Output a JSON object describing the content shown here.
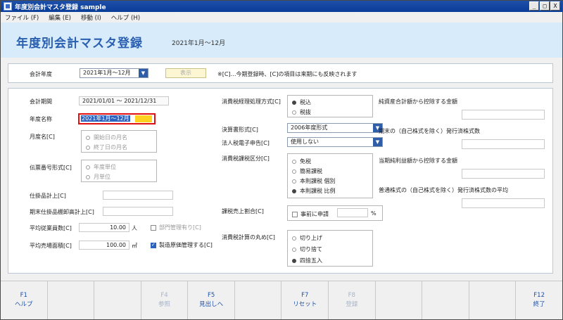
{
  "window": {
    "title": "年度別会計マスタ登録 sample",
    "controls": [
      "_",
      "□",
      "X"
    ]
  },
  "menu": [
    "ファイル (F)",
    "編集 (E)",
    "移動 (I)",
    "ヘルプ (H)"
  ],
  "header": {
    "title": "年度別会計マスタ登録",
    "subtitle": "2021年1月～12月"
  },
  "top": {
    "fiscal_year_label": "会計年度",
    "fiscal_year_value": "2021年1月～12月",
    "show_button": "表示",
    "note": "※[C]…今期登録時、[C]の項目は来期にも反映されます"
  },
  "left": {
    "period_label": "会計期間",
    "period_value": "2021/01/01 ～ 2021/12/31",
    "year_name_label": "年度名称",
    "year_name_value": "2021年1月～12月",
    "month_name_label": "月度名[C]",
    "month_name_options": [
      "開始日の月名",
      "終了日の月名"
    ],
    "slip_format_label": "伝票番号形式[C]",
    "slip_format_options": [
      "年度単位",
      "月単位"
    ],
    "purchase_label": "仕掛品計上[C]",
    "inventory_label": "期末仕掛品棚卸高計上[C]",
    "employees_label": "平均従業員数[C]",
    "employees_value": "10.00",
    "employees_unit": "人",
    "area_label": "平均売場面積[C]",
    "area_value": "100.00",
    "area_unit": "㎡",
    "dept_mgmt_label": "部門管理有り[C]",
    "manufacturing_label": "製造原価管理する[C]"
  },
  "middle": {
    "tax_method_label": "消費税経理処理方式[C]",
    "tax_method_options": [
      "税込",
      "税抜"
    ],
    "statement_label": "決算書形式[C]",
    "statement_value": "2006年度形式",
    "etax_label": "法人税電子申告[C]",
    "etax_value": "使用しない",
    "tax_category_label": "消費税課税区分[C]",
    "tax_category_options": [
      "免税",
      "簡易課税",
      "本則課税 個別",
      "本則課税 比例"
    ],
    "taxable_ratio_label": "課税売上割合[C]",
    "pre_apply_label": "事前に申請",
    "percent": "%",
    "rounding_label": "消費税計算の丸め[C]",
    "rounding_options": [
      "切り上げ",
      "切り捨て",
      "四捨五入"
    ]
  },
  "right": {
    "net_assets_label": "純資産合計額から控除する金額",
    "shares_label": "期末の（自己株式を除く）発行済株式数",
    "net_income_label": "当期純利益額から控除する金額",
    "avg_shares_label": "普通株式の（自己株式を除く）発行済株式数の平均"
  },
  "fkeys": [
    {
      "key": "F1",
      "label": "ヘルプ"
    },
    {
      "key": "",
      "label": ""
    },
    {
      "key": "",
      "label": ""
    },
    {
      "key": "F4",
      "label": "参照"
    },
    {
      "key": "F5",
      "label": "見出しへ"
    },
    {
      "key": "",
      "label": ""
    },
    {
      "key": "F7",
      "label": "リセット"
    },
    {
      "key": "F8",
      "label": "登録"
    },
    {
      "key": "",
      "label": ""
    },
    {
      "key": "",
      "label": ""
    },
    {
      "key": "",
      "label": ""
    },
    {
      "key": "F12",
      "label": "終了"
    }
  ]
}
